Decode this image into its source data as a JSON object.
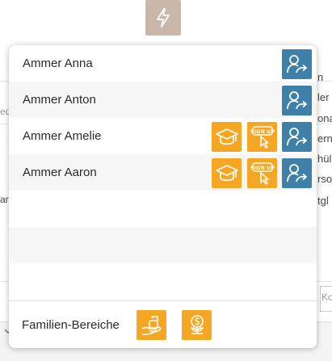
{
  "background": {
    "right_fragments": [
      "n",
      "ler",
      "ona",
      "ern",
      "hül",
      "rso",
      "tgl"
    ],
    "left_fragments": [
      "ed",
      "ar"
    ],
    "bottom_right_text": "Ko"
  },
  "trigger": {
    "icon": "lightning-icon",
    "color": "#c9b7aa"
  },
  "popover": {
    "members": [
      {
        "name": "Ammer Anna",
        "actions": [
          "switch-user"
        ]
      },
      {
        "name": "Ammer Anton",
        "actions": [
          "switch-user"
        ]
      },
      {
        "name": "Ammer Amelie",
        "actions": [
          "education",
          "signup",
          "switch-user"
        ]
      },
      {
        "name": "Ammer Aaron",
        "actions": [
          "education",
          "signup",
          "switch-user"
        ]
      }
    ],
    "signup_badge_text": "SIGN UP",
    "footer": {
      "label": "Familien-Bereiche",
      "buttons": [
        "family-care",
        "finance"
      ]
    }
  },
  "colors": {
    "blue": "#3e80a8",
    "orange": "#f5a623"
  }
}
